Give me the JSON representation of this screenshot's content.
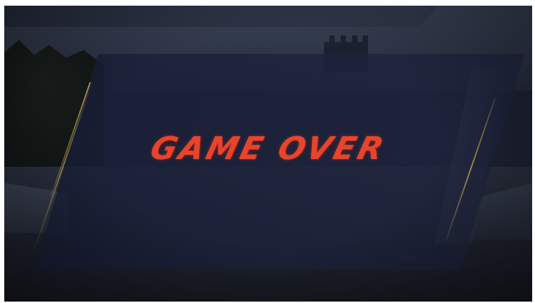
{
  "screen": {
    "title": "GAME OVER",
    "title_color": "#e8442c",
    "accent_color": "#c8af50",
    "panel_color": "#1c2240"
  }
}
